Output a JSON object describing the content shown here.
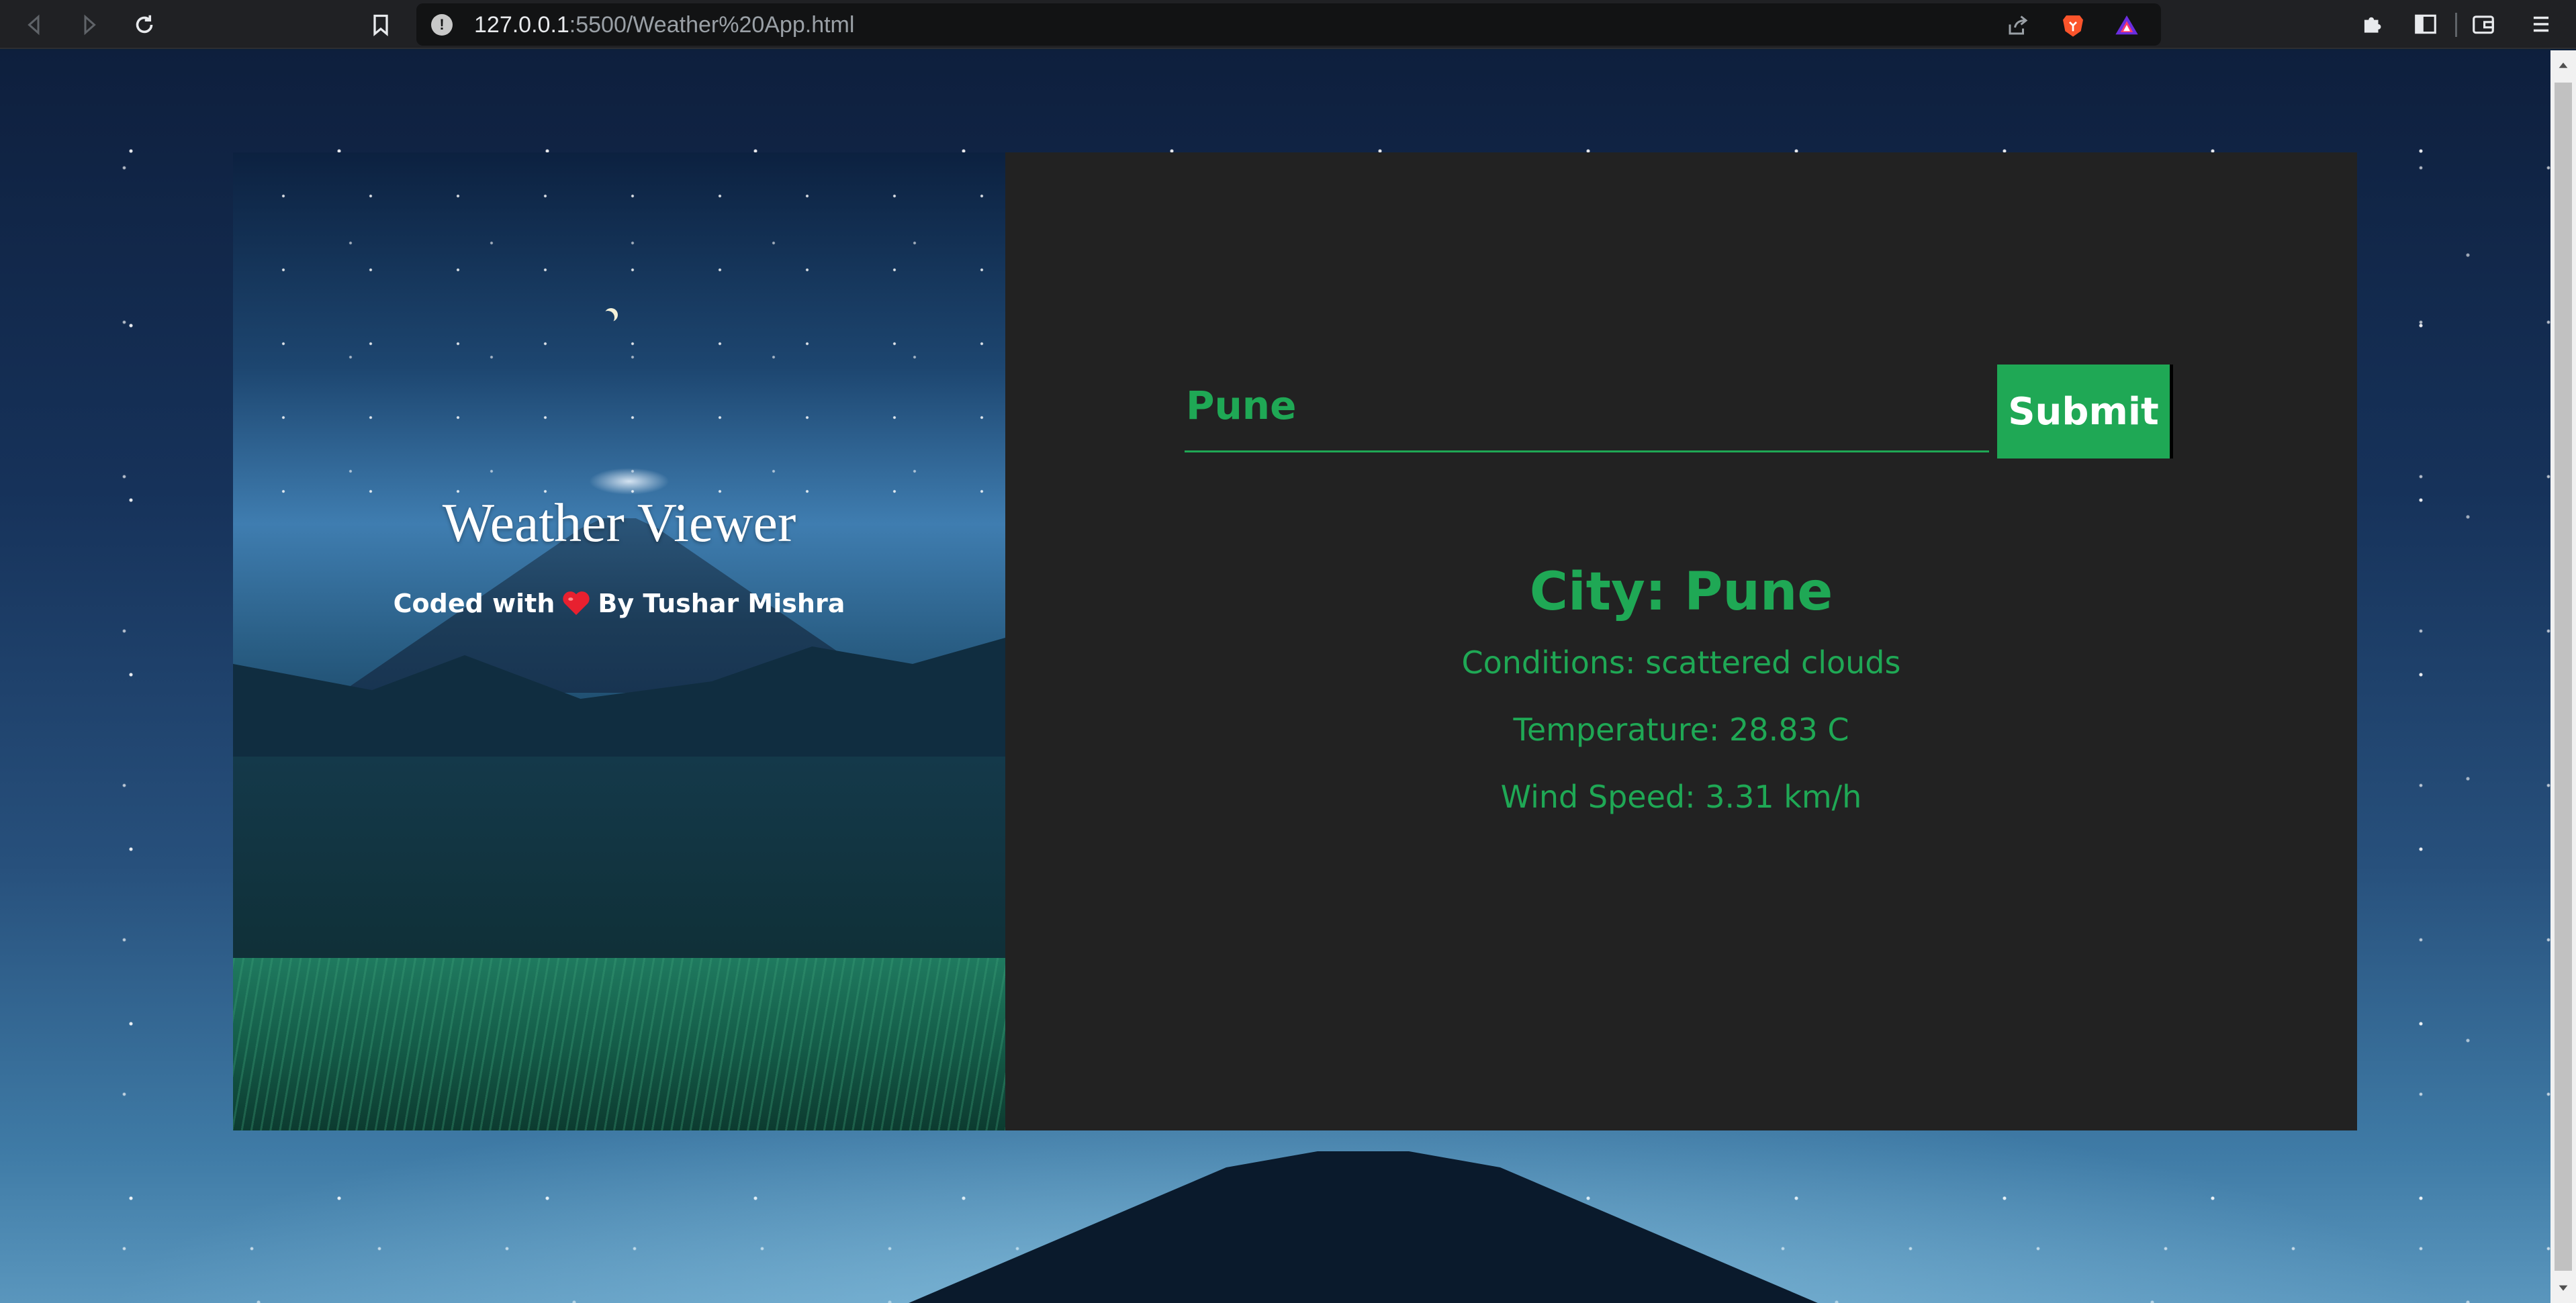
{
  "browser": {
    "url_host": "127.0.0.1",
    "url_path": ":5500/Weather%20App.html"
  },
  "app": {
    "title": "Weather Viewer",
    "byline_prefix": "Coded with",
    "byline_suffix": "By Tushar Mishra",
    "accent_color": "#1fa855"
  },
  "form": {
    "city_value": "Pune",
    "submit_label": "Submit"
  },
  "result": {
    "city": "City: Pune",
    "conditions": "Conditions: scattered clouds",
    "temperature": "Temperature: 28.83 C",
    "wind_speed": "Wind Speed: 3.31 km/h"
  }
}
